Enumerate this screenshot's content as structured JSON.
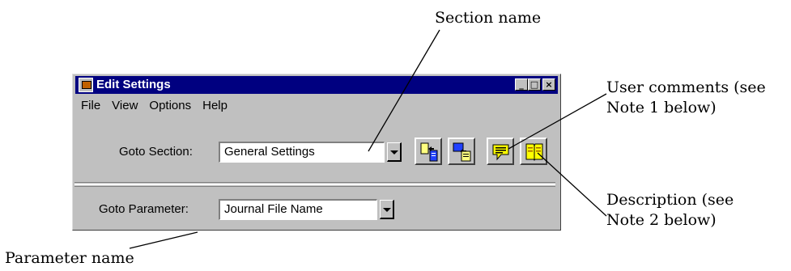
{
  "callouts": {
    "section_name": "Section name",
    "user_comments_line1": "User comments (see",
    "user_comments_line2": "Note 1 below)",
    "description_line1": "Description (see",
    "description_line2": "Note 2 below)",
    "parameter_name": "Parameter name"
  },
  "window": {
    "title": "Edit Settings",
    "controls": {
      "minimize": "_",
      "maximize": "□",
      "close": "×"
    }
  },
  "menu": [
    "File",
    "View",
    "Options",
    "Help"
  ],
  "section": {
    "label": "Goto Section:",
    "value": "General Settings"
  },
  "parameter": {
    "label": "Goto Parameter:",
    "value": "Journal File Name"
  },
  "toolbar_icons": [
    "copy-section-icon",
    "paste-section-icon",
    "user-comments-icon",
    "description-book-icon"
  ],
  "colors": {
    "titlebar": "#000080",
    "window_face": "#c0c0c0"
  }
}
